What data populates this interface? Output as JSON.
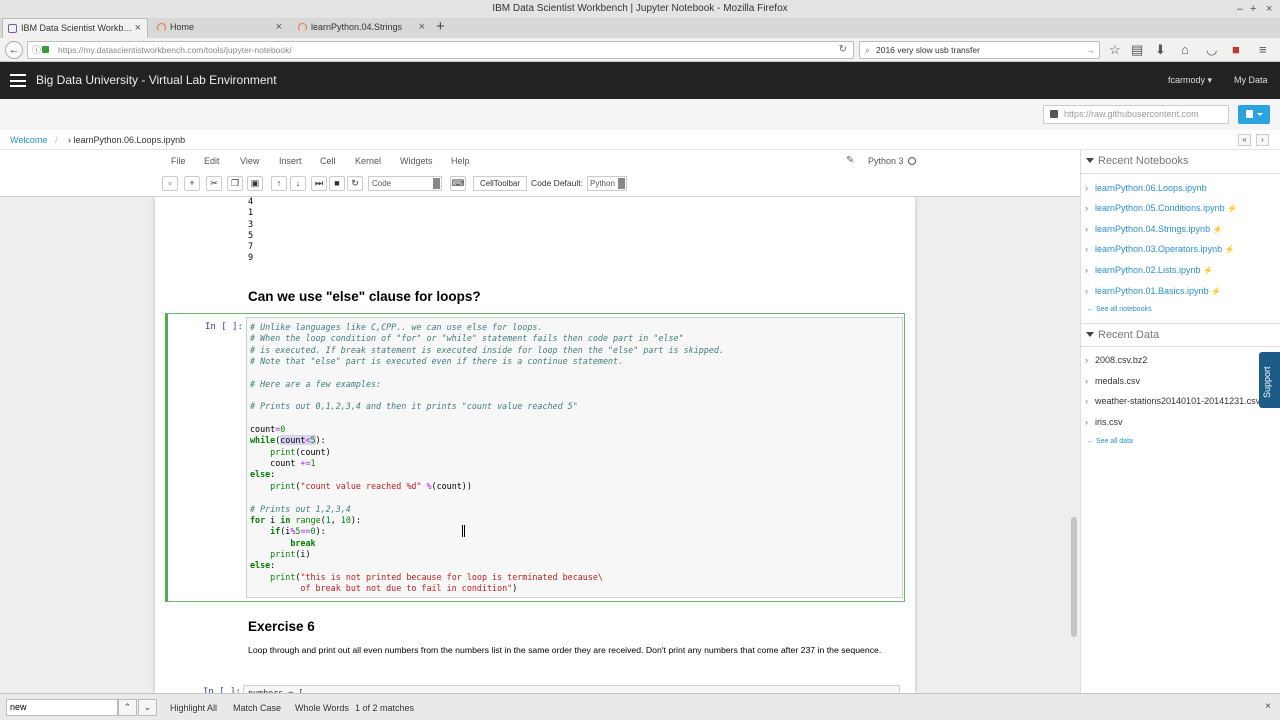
{
  "window": {
    "title": "IBM Data Scientist Workbench | Jupyter Notebook - Mozilla Firefox",
    "controls": [
      "–",
      "+",
      "×"
    ]
  },
  "browser": {
    "tabs": [
      {
        "label": "IBM Data Scientist Workb…",
        "active": true
      },
      {
        "label": "Home",
        "active": false
      },
      {
        "label": "learnPython.04.Strings",
        "active": false
      }
    ],
    "url": "https://my.datascientistworkbench.com/tools/jupyter-notebook/",
    "search_value": "2016 very slow usb transfer"
  },
  "app": {
    "title": "Big Data University - Virtual Lab Environment",
    "user": "fcarmody",
    "my_data": "My Data",
    "raw_url_placeholder": "https://raw.githubusercontent.com"
  },
  "breadcrumb": {
    "home": "Welcome",
    "current": "learnPython.06.Loops.ipynb"
  },
  "notebook": {
    "menu": [
      "File",
      "Edit",
      "View",
      "Insert",
      "Cell",
      "Kernel",
      "Widgets",
      "Help"
    ],
    "kernel": "Python 3",
    "cell_type": "Code",
    "celltoolbar_label": "CellToolbar",
    "code_default_label": "Code Default:",
    "code_default_value": "Python",
    "output_lines": [
      "4",
      "1",
      "3",
      "5",
      "7",
      "9"
    ],
    "heading_else": "Can we use \"else\" clause for loops?",
    "prompt": "In [ ]:",
    "heading_exercise": "Exercise 6",
    "exercise_text": "Loop through and print out all even numbers from the numbers list in the same order they are received. Don't print any numbers that come after 237 in the sequence.",
    "next_cell_code": "numbers = ["
  },
  "right_panel": {
    "recent_notebooks_title": "Recent Notebooks",
    "notebooks": [
      {
        "name": "learnPython.06.Loops.ipynb",
        "bolt": false
      },
      {
        "name": "learnPython.05.Conditions.ipynb",
        "bolt": true
      },
      {
        "name": "learnPython.04.Strings.ipynb",
        "bolt": true
      },
      {
        "name": "learnPython.03.Operators.ipynb",
        "bolt": true
      },
      {
        "name": "learnPython.02.Lists.ipynb",
        "bolt": true
      },
      {
        "name": "learnPython.01.Basics.ipynb",
        "bolt": true
      }
    ],
    "see_all_notebooks": "← See all notebooks",
    "recent_data_title": "Recent Data",
    "data_files": [
      "2008.csv.bz2",
      "medals.csv",
      "weather-stations20140101-20141231.csv",
      "iris.csv"
    ],
    "see_all_data": "← See all data",
    "support_label": "Support"
  },
  "findbar": {
    "query": "new",
    "highlight_all": "Highlight All",
    "match_case": "Match Case",
    "whole_words": "Whole Words",
    "status": "1 of 2 matches"
  },
  "colors": {
    "header_bg": "#222222",
    "link": "#2a8fd0",
    "cell_border": "#4caf50",
    "support_bg": "#1c5c86"
  }
}
